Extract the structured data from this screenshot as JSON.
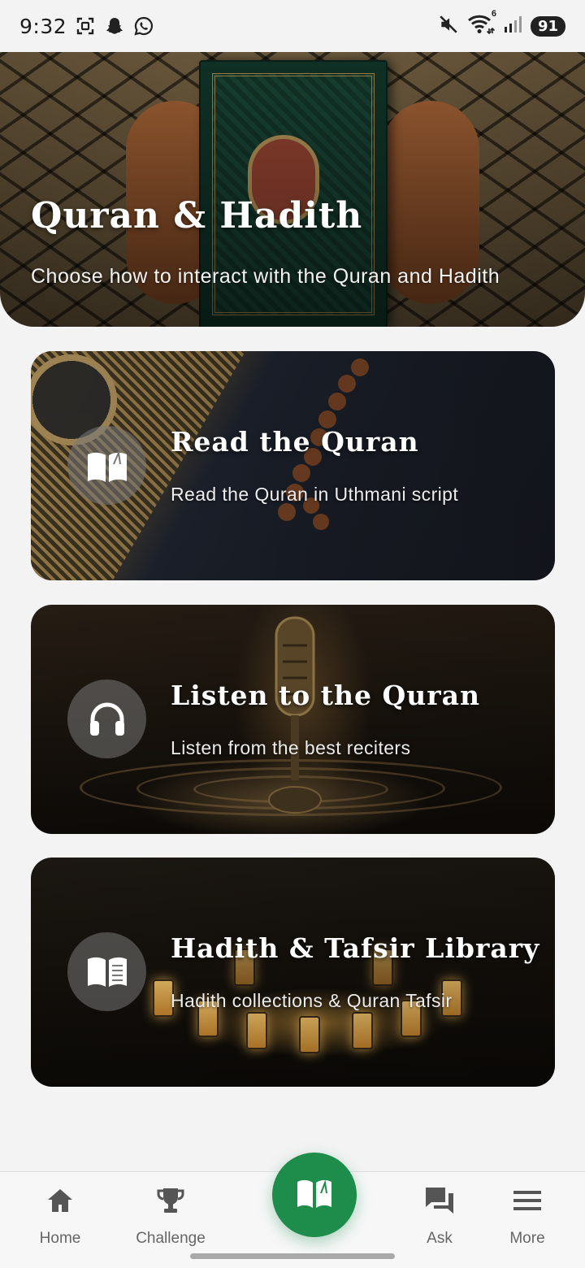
{
  "status_bar": {
    "time": "9:32",
    "battery": "91",
    "wifi_badge": "6",
    "left_icons": [
      "screenshot-icon",
      "snapchat-icon",
      "whatsapp-icon"
    ],
    "right_icons": [
      "mute-icon",
      "wifi-icon",
      "signal-icon"
    ]
  },
  "hero": {
    "title": "Quran & Hadith",
    "subtitle": "Choose how to interact with the Quran and Hadith"
  },
  "cards": [
    {
      "title": "Read the Quran",
      "subtitle": "Read the Quran in Uthmani script",
      "icon": "open-book-icon"
    },
    {
      "title": "Listen to the Quran",
      "subtitle": "Listen from the best reciters",
      "icon": "headphones-icon"
    },
    {
      "title": "Hadith & Tafsir Library",
      "subtitle": "Hadith collections & Quran Tafsir",
      "icon": "book-text-icon"
    }
  ],
  "bottom_nav": {
    "items": [
      {
        "label": "Home",
        "icon": "home-icon"
      },
      {
        "label": "Challenge",
        "icon": "trophy-icon"
      },
      {
        "label": "Ask",
        "icon": "chat-icon"
      },
      {
        "label": "More",
        "icon": "menu-icon"
      }
    ],
    "fab_icon": "quran-book-icon"
  },
  "colors": {
    "accent": "#1e8c4a",
    "background": "#f3f3f4",
    "nav_label": "#666666"
  }
}
